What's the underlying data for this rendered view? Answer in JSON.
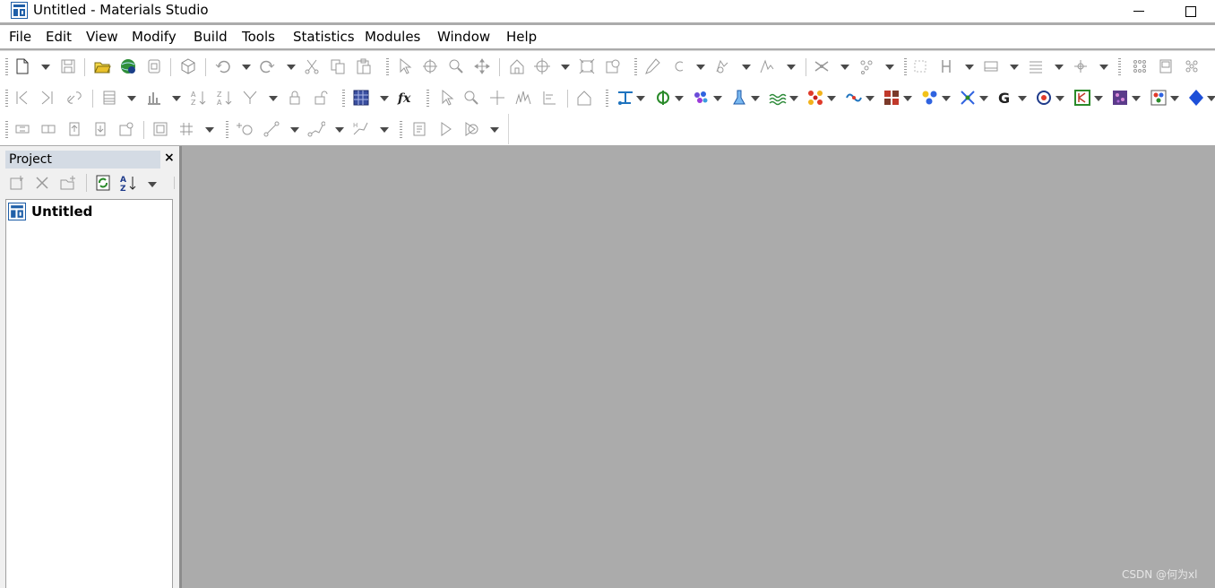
{
  "window": {
    "title": "Untitled - Materials Studio",
    "minimize_icon": "minimize-icon",
    "maximize_icon": "maximize-icon"
  },
  "menu": [
    "File",
    "Edit",
    "View",
    "Modify",
    "Build",
    "Tools",
    "Statistics",
    "Modules",
    "Window",
    "Help"
  ],
  "toolbar": {
    "row1": [
      "new-document-icon",
      "dropdown",
      "save-icon",
      "open-folder-icon",
      "internet-icon",
      "print-icon",
      "3d-cube-icon",
      "undo-icon",
      "dropdown",
      "redo-icon",
      "dropdown",
      "cut-icon",
      "copy-icon",
      "paste-icon",
      "select-arrow-icon",
      "rotate-icon",
      "zoom-icon",
      "translate-icon",
      "home-view-icon",
      "center-icon",
      "dropdown",
      "fit-screen-icon",
      "display-style-icon",
      "sketch-pencil-icon",
      "ring-icon",
      "dropdown",
      "sketch-fragment-icon",
      "dropdown",
      "sketch-chain-icon",
      "dropdown",
      "bond-icon",
      "dropdown",
      "atom-cluster-icon",
      "dropdown",
      "symmetry-icon",
      "hydrogen-icon",
      "dropdown",
      "cell-icon",
      "dropdown",
      "layers-icon",
      "dropdown",
      "crystal-icon",
      "dropdown",
      "lattice-icon",
      "supercell-icon",
      "nanostructure-icon"
    ],
    "row2": [
      "nav-prev-icon",
      "nav-next-icon",
      "link-icon",
      "table-icon",
      "dropdown",
      "chart-icon",
      "dropdown",
      "sort-ascending-icon",
      "sort-descending-icon",
      "filter-icon",
      "dropdown",
      "lock-icon",
      "unlock-icon",
      "study-table-icon",
      "dropdown",
      "function-icon",
      "select-arrow-icon",
      "zoom-icon",
      "translate-icon",
      "spectrum-icon",
      "axis-icon",
      "home-view-icon",
      "module-1-icon",
      "module-2-icon",
      "module-3-icon",
      "module-4-icon",
      "module-5-icon",
      "module-6-icon",
      "module-7-icon",
      "module-8-icon",
      "module-9-icon",
      "module-10-icon",
      "module-11-icon",
      "module-12-icon",
      "module-13-icon",
      "module-14-icon",
      "module-15-icon"
    ],
    "row3": [
      "align-left-icon",
      "align-center-icon",
      "align-top-icon",
      "align-bottom-icon",
      "properties-icon",
      "group-icon",
      "grid-icon",
      "dropdown",
      "point-icon",
      "line-icon",
      "dropdown",
      "chain-icon",
      "dropdown",
      "path-icon",
      "dropdown",
      "script-icon",
      "run-icon",
      "debug-icon",
      "dropdown"
    ]
  },
  "project": {
    "title": "Project",
    "close_icon": "close-icon",
    "toolbar": [
      "new-folder-icon",
      "delete-icon",
      "new-file-icon",
      "refresh-icon",
      "sort-az-icon",
      "dropdown"
    ],
    "tree": [
      {
        "label": "Untitled",
        "icon": "materials-studio-project-icon"
      }
    ]
  },
  "watermark": "CSDN @何为xl",
  "colors": {
    "workspace": "#ababab",
    "panel_header": "#d4dbe4",
    "accent_blue": "#1e73be"
  }
}
